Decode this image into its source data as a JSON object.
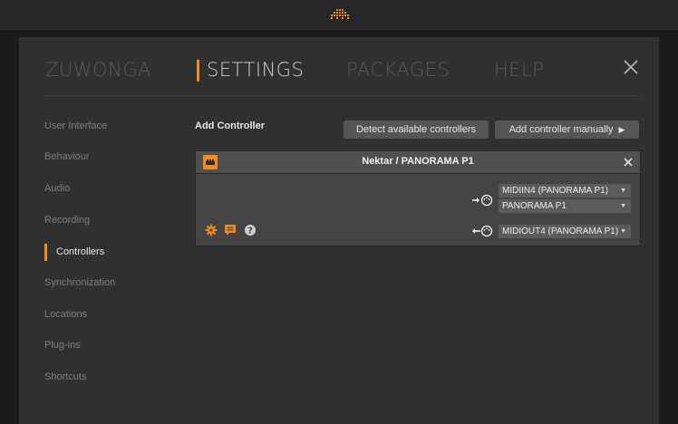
{
  "window": {
    "brand_accent": "#f08c1d",
    "logo_icon": "app-logo-icon"
  },
  "nav": {
    "tabs": [
      {
        "label": "ZUWONGA",
        "active": false
      },
      {
        "label": "SETTINGS",
        "active": true
      },
      {
        "label": "PACKAGES",
        "active": false
      },
      {
        "label": "HELP",
        "active": false
      }
    ],
    "close_icon": "close-icon"
  },
  "sidebar": {
    "items": [
      {
        "label": "User Interface",
        "active": false
      },
      {
        "label": "Behaviour",
        "active": false
      },
      {
        "label": "Audio",
        "active": false
      },
      {
        "label": "Recording",
        "active": false
      },
      {
        "label": "Controllers",
        "active": true
      },
      {
        "label": "Synchronization",
        "active": false
      },
      {
        "label": "Locations",
        "active": false
      },
      {
        "label": "Plug-ins",
        "active": false
      },
      {
        "label": "Shortcuts",
        "active": false
      }
    ]
  },
  "main": {
    "section_title": "Add Controller",
    "detect_button": "Detect available controllers",
    "add_manual_button": "Add controller manually",
    "controller": {
      "title": "Nektar / PANORAMA P1",
      "midi_in": "MIDIIN4 (PANORAMA P1)",
      "midi_in_2": "PANORAMA P1",
      "midi_out": "MIDIOUT4 (PANORAMA P1)",
      "icons": [
        "controller-icon",
        "settings-icon",
        "comment-icon",
        "help-icon",
        "midi-in-icon",
        "midi-out-icon"
      ]
    }
  }
}
